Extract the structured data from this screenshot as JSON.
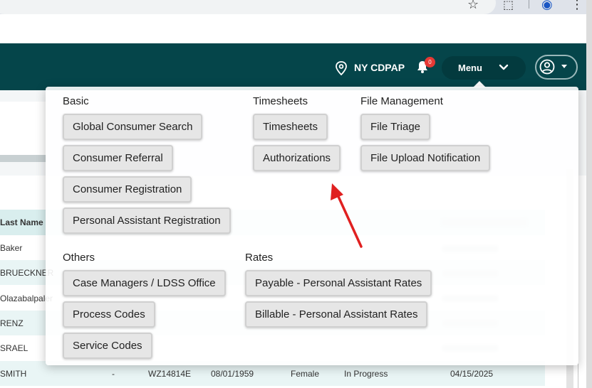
{
  "header": {
    "location_label": "NY CDPAP",
    "notification_count": "0",
    "menu_label": "Menu"
  },
  "colors": {
    "header_bg": "#05454a",
    "badge": "#e53935",
    "arrow": "#e02020"
  },
  "icons": [
    "star-icon",
    "extension-icon",
    "profile-icon",
    "kebab-icon",
    "location-icon",
    "bell-icon",
    "chevron-down-icon",
    "user-circle-icon",
    "caret-down-icon"
  ],
  "dropdown": {
    "basic": {
      "title": "Basic",
      "items": [
        "Global Consumer Search",
        "Consumer Referral",
        "Consumer Registration",
        "Personal Assistant Registration"
      ]
    },
    "timesheets": {
      "title": "Timesheets",
      "items": [
        "Timesheets",
        "Authorizations"
      ]
    },
    "file_management": {
      "title": "File Management",
      "items": [
        "File Triage",
        "File Upload Notification"
      ]
    },
    "others": {
      "title": "Others",
      "items": [
        "Case Managers / LDSS Office",
        "Process Codes",
        "Service Codes"
      ]
    },
    "rates": {
      "title": "Rates",
      "items": [
        "Payable - Personal Assistant Rates",
        "Billable - Personal Assistant Rates"
      ]
    }
  },
  "table": {
    "header_last_name": "Last Name",
    "rows": [
      {
        "last_name": "Baker"
      },
      {
        "last_name": "BRUECKNER"
      },
      {
        "last_name": "Olazabalpaler"
      },
      {
        "last_name": "RENZ"
      },
      {
        "last_name": "SRAEL"
      },
      {
        "last_name": "SMITH",
        "col2": "-",
        "id": "WZ14814E",
        "dob": "08/01/1959",
        "gender": "Female",
        "status": "In Progress",
        "date": "04/15/2025"
      }
    ]
  }
}
